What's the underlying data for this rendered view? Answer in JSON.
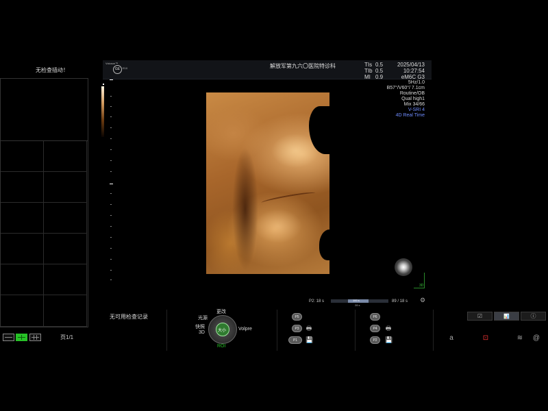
{
  "left_panel": {
    "message": "无检查插动！",
    "page_label": "页1/1"
  },
  "header": {
    "logo_text": "Voluson™",
    "logo_ge": "GE",
    "logo_model": "E10",
    "hospital": "解放军第九六〇医院特诊科",
    "indices": [
      {
        "label": "TIs",
        "value": "0.5"
      },
      {
        "label": "TIb",
        "value": "0.5"
      },
      {
        "label": "MI",
        "value": "0.9"
      }
    ],
    "date": "2025/04/13",
    "time": "10:27:54",
    "probe": "eM6C G3"
  },
  "scan_info": [
    "5Hz/1.0",
    "B57°/V60°/ 7.1cm",
    "Routine/OB",
    "Qual high1",
    "Mix 34/66"
  ],
  "scan_info_blue": [
    "V-SRI 4",
    "4D Real Time"
  ],
  "orientation": {
    "axis_label": "3D"
  },
  "cine": {
    "start_label": "P2:  18 s",
    "inner_label": "100 s",
    "mid_label": "28 s",
    "end_label": "89 / 18 s"
  },
  "bottom": {
    "no_record": "无可用检查记录",
    "knob": {
      "top": "更改",
      "left_top": "光源",
      "left_mid": "快照",
      "left_low": "3D",
      "right": "Volpre",
      "center": "大小",
      "roi": "ROI"
    },
    "p_buttons_left": [
      "P5",
      "P3",
      "P1"
    ],
    "p_buttons_right": [
      "P6",
      "P4",
      "P2"
    ]
  },
  "right_tabs": {
    "icons": [
      "check-icon",
      "chart-icon",
      "info-icon"
    ],
    "glyphs": [
      "☑",
      "📊",
      "ⓘ"
    ],
    "bottom_letter": "a"
  },
  "colors": {
    "accent_green": "#27c227",
    "blue_text": "#6f8cff",
    "render_gold": "#c98a45"
  }
}
